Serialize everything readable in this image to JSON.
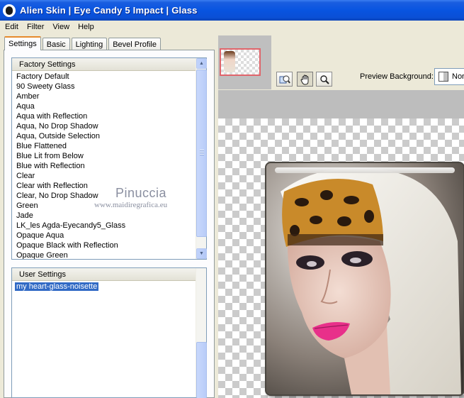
{
  "window": {
    "title": "Alien Skin  |  Eye Candy 5 Impact  |  Glass"
  },
  "menu": [
    "Edit",
    "Filter",
    "View",
    "Help"
  ],
  "tabs": [
    "Settings",
    "Basic",
    "Lighting",
    "Bevel Profile"
  ],
  "active_tab": "Settings",
  "factory_settings": {
    "header": "Factory Settings",
    "items": [
      "Factory Default",
      "90 Sweety Glass",
      "Amber",
      "Aqua",
      "Aqua with Reflection",
      "Aqua, No Drop Shadow",
      "Aqua, Outside Selection",
      "Blue Flattened",
      "Blue Lit from Below",
      "Blue with Reflection",
      "Clear",
      "Clear with Reflection",
      "Clear, No Drop Shadow",
      "Green",
      "Jade",
      "LK_les Agda-Eyecandy5_Glass",
      "Opaque Aqua",
      "Opaque Black with Reflection",
      "Opaque Green"
    ]
  },
  "user_settings": {
    "header": "User Settings",
    "items": [
      "my heart-glass-noisette"
    ],
    "selected": "my heart-glass-noisette"
  },
  "watermark": {
    "name": "Pinuccia",
    "site": "www.maidiregrafica.eu"
  },
  "preview": {
    "background_label": "Preview Background:",
    "background_value": "Nor"
  },
  "icons": {
    "zoom_fit": "zoom-fit-icon",
    "hand": "hand-icon",
    "zoom": "magnifier-icon"
  },
  "colors": {
    "titlebar": "#0854e0",
    "selection": "#316ac5",
    "tab_accent": "#e68b2c"
  }
}
